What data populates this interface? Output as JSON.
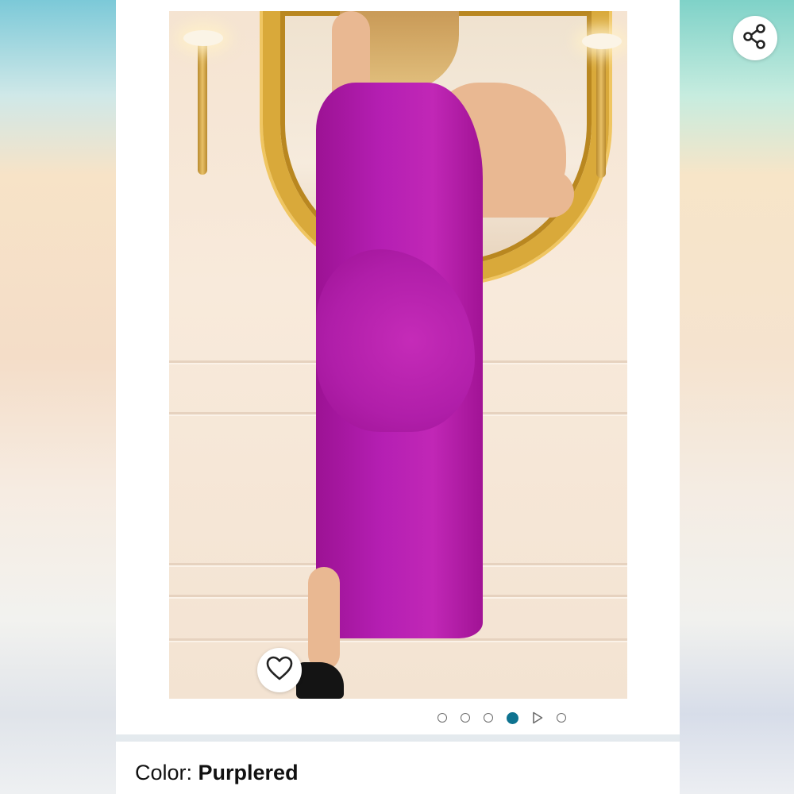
{
  "product_gallery": {
    "image_alt": "Woman wearing a one-shoulder purple midi dress",
    "current_slide": 4,
    "slides": [
      {
        "type": "image"
      },
      {
        "type": "image"
      },
      {
        "type": "image"
      },
      {
        "type": "image"
      },
      {
        "type": "video"
      },
      {
        "type": "image"
      }
    ]
  },
  "actions": {
    "share_icon": "share-icon",
    "wishlist_icon": "heart-icon"
  },
  "variation": {
    "label": "Color: ",
    "value": "Purplered"
  },
  "colors": {
    "accent": "#0e7390",
    "dress": "#b51fb3",
    "card": "#ffffff",
    "text": "#111111"
  }
}
